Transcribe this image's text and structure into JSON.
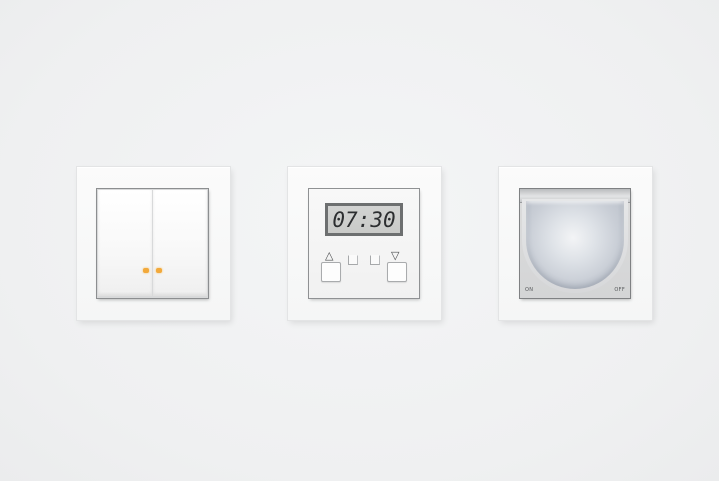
{
  "timer": {
    "display_time": "07:30",
    "up_arrow": "△",
    "down_arrow": "▽"
  },
  "sensor": {
    "on_label": "ON",
    "off_label": "OFF"
  },
  "colors": {
    "background": "#f2f3f4",
    "frame": "#f8f8f8",
    "led_indicator": "#f2a93b",
    "lcd_background": "#cbccca",
    "lens_tint": "#c9ced6"
  },
  "icons": {
    "switch_indicator": "led-dot",
    "timer_up": "triangle-up-icon",
    "timer_down": "triangle-down-icon"
  }
}
